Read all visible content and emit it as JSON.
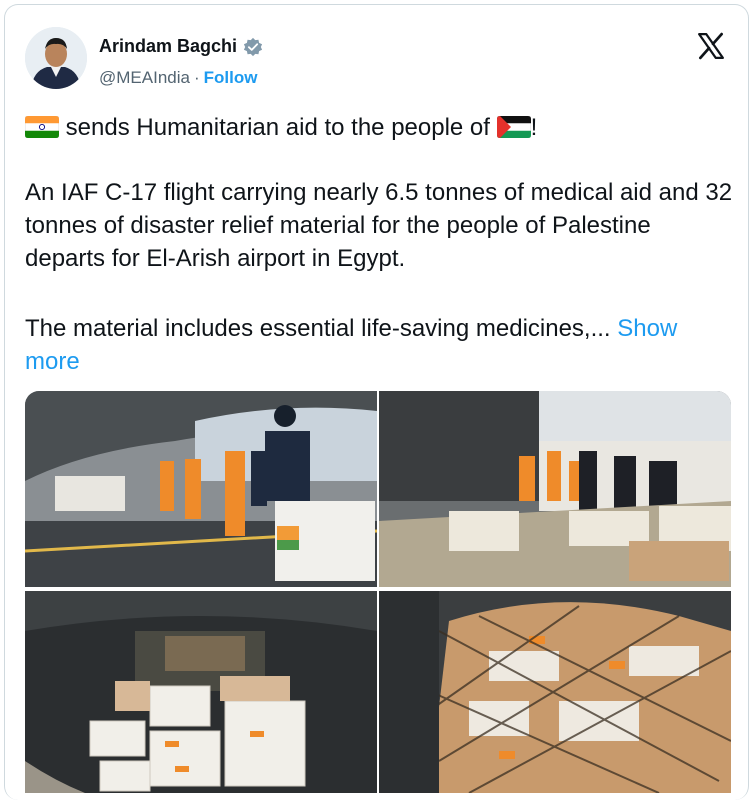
{
  "author": {
    "name": "Arindam Bagchi",
    "handle": "@MEAIndia",
    "separator": "·",
    "follow_label": "Follow",
    "avatar_icon": "person-avatar"
  },
  "tweet": {
    "line1_text": "sends Humanitarian aid to the people of",
    "line1_suffix": "!",
    "paragraph2": "An IAF C-17 flight carrying nearly 6.5 tonnes of medical aid and 32 tonnes of disaster relief material for the people of Palestine departs for El-Arish airport in Egypt.",
    "paragraph3": "The material includes essential life-saving medicines,...",
    "show_more": "Show more"
  },
  "icons": {
    "x_logo": "x-logo-icon",
    "verified": "verified-badge-icon",
    "flag_india": "india-flag-icon",
    "flag_palestine": "palestine-flag-icon"
  },
  "colors": {
    "accent": "#1d9bf0",
    "text": "#0f1419",
    "secondary": "#536471",
    "border": "#cfd9de"
  },
  "media": {
    "photos": [
      "photo-loading-boxes",
      "photo-cargo-ramp",
      "photo-cargo-hold",
      "photo-netted-pallet"
    ]
  }
}
